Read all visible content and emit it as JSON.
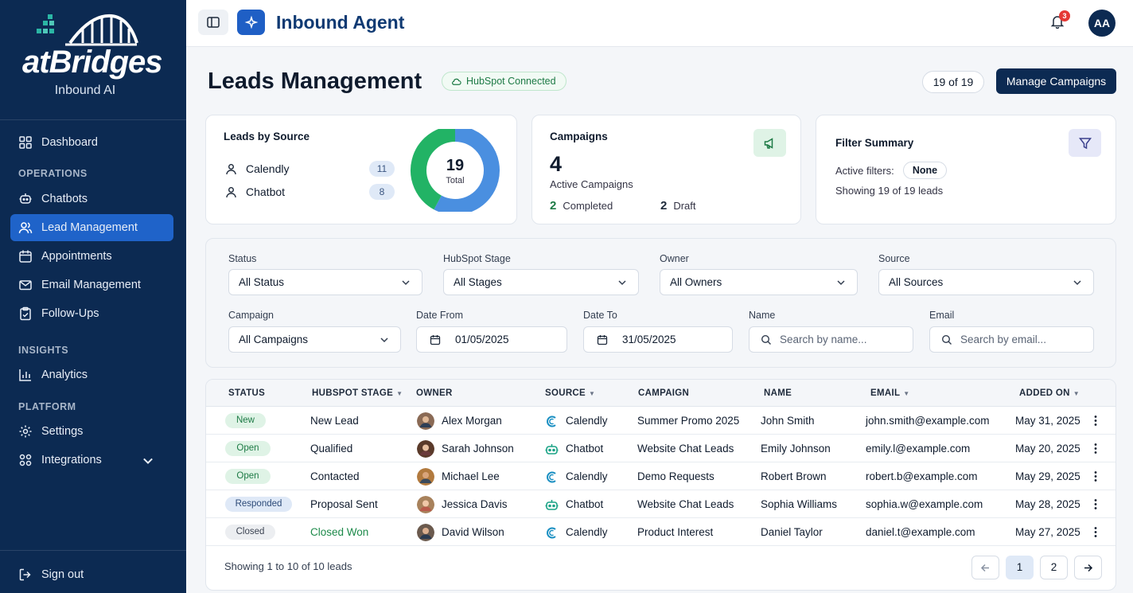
{
  "brand": {
    "name": "atBridges",
    "subtitle": "Inbound AI"
  },
  "sidebar": {
    "dashboard": "Dashboard",
    "sections": {
      "operations": "OPERATIONS",
      "insights": "INSIGHTS",
      "platform": "PLATFORM"
    },
    "items": [
      {
        "label": "Chatbots"
      },
      {
        "label": "Lead Management"
      },
      {
        "label": "Appointments"
      },
      {
        "label": "Email Management"
      },
      {
        "label": "Follow-Ups"
      },
      {
        "label": "Analytics"
      },
      {
        "label": "Settings"
      },
      {
        "label": "Integrations"
      }
    ],
    "signout": "Sign out"
  },
  "topbar": {
    "title": "Inbound Agent",
    "notification_count": "3",
    "avatar": "AA"
  },
  "header": {
    "title": "Leads Management",
    "hubspot": "HubSpot Connected",
    "count": "19 of 19",
    "manage_button": "Manage Campaigns"
  },
  "leads_by_source": {
    "title": "Leads by Source",
    "sources": [
      {
        "label": "Calendly",
        "count": "11"
      },
      {
        "label": "Chatbot",
        "count": "8"
      }
    ],
    "total": "19",
    "total_label": "Total",
    "colors": {
      "calendly": "#4a8fe0",
      "chatbot": "#22b365"
    }
  },
  "campaigns": {
    "title": "Campaigns",
    "count": "4",
    "subtitle": "Active Campaigns",
    "completed_count": "2",
    "completed_label": "Completed",
    "draft_count": "2",
    "draft_label": "Draft"
  },
  "filter_summary": {
    "title": "Filter Summary",
    "active_label": "Active filters:",
    "active_value": "None",
    "showing": "Showing 19 of 19 leads"
  },
  "filters": {
    "status": {
      "label": "Status",
      "value": "All Status"
    },
    "stage": {
      "label": "HubSpot Stage",
      "value": "All Stages"
    },
    "owner": {
      "label": "Owner",
      "value": "All Owners"
    },
    "source": {
      "label": "Source",
      "value": "All Sources"
    },
    "campaign": {
      "label": "Campaign",
      "value": "All Campaigns"
    },
    "date_from": {
      "label": "Date From",
      "value": "01/05/2025"
    },
    "date_to": {
      "label": "Date To",
      "value": "31/05/2025"
    },
    "name": {
      "label": "Name",
      "placeholder": "Search by name..."
    },
    "email": {
      "label": "Email",
      "placeholder": "Search by email..."
    }
  },
  "table": {
    "headers": [
      "STATUS",
      "HUBSPOT STAGE",
      "OWNER",
      "SOURCE",
      "CAMPAIGN",
      "NAME",
      "EMAIL",
      "ADDED ON"
    ],
    "rows": [
      {
        "status": "New",
        "stage": "New Lead",
        "owner": "Alex Morgan",
        "source": "Calendly",
        "campaign": "Summer Promo 2025",
        "name": "John Smith",
        "email": "john.smith@example.com",
        "added": "May 31, 2025"
      },
      {
        "status": "Open",
        "stage": "Qualified",
        "owner": "Sarah Johnson",
        "source": "Chatbot",
        "campaign": "Website Chat Leads",
        "name": "Emily Johnson",
        "email": "emily.l@example.com",
        "added": "May 20, 2025"
      },
      {
        "status": "Open",
        "stage": "Contacted",
        "owner": "Michael Lee",
        "source": "Calendly",
        "campaign": "Demo Requests",
        "name": "Robert Brown",
        "email": "robert.b@example.com",
        "added": "May 29, 2025"
      },
      {
        "status": "Responded",
        "stage": "Proposal Sent",
        "owner": "Jessica Davis",
        "source": "Chatbot",
        "campaign": "Website Chat Leads",
        "name": "Sophia Williams",
        "email": "sophia.w@example.com",
        "added": "May 28, 2025"
      },
      {
        "status": "Closed",
        "stage": "Closed Won",
        "owner": "David Wilson",
        "source": "Calendly",
        "campaign": "Product Interest",
        "name": "Daniel Taylor",
        "email": "daniel.t@example.com",
        "added": "May 27, 2025"
      }
    ],
    "footer": "Showing 1 to 10 of 10 leads",
    "pages": [
      "1",
      "2"
    ]
  }
}
